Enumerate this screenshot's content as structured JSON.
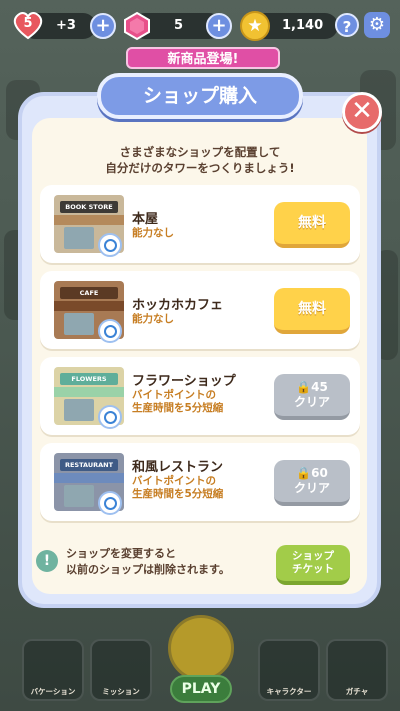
{
  "hud": {
    "lives": "5",
    "lives_bonus": "+3",
    "gems": "5",
    "coins": "1,140",
    "help_label": "?"
  },
  "new_badge": "新商品登場!",
  "modal": {
    "title": "ショップ購入",
    "intro_line1": "さまざまなショップを配置して",
    "intro_line2": "自分だけのタワーをつくりましょう!",
    "shops": [
      {
        "sign": "BOOK STORE",
        "name": "本屋",
        "desc1": "能力なし",
        "desc2": "",
        "button": "無料",
        "locked": false,
        "sign_color": "#3d3a36",
        "awning_color": "#b48a5c"
      },
      {
        "sign": "CAFE",
        "name": "ホッカホカフェ",
        "desc1": "能力なし",
        "desc2": "",
        "button": "無料",
        "locked": false,
        "sign_color": "#5b3a24",
        "awning_color": "#7a4a2a"
      },
      {
        "sign": "FLOWERS",
        "name": "フラワーショップ",
        "desc1": "バイトポイントの",
        "desc2": "生産時間を5分短縮",
        "button_num": "45",
        "button_label": "クリア",
        "locked": true,
        "sign_color": "#5fae9a",
        "awning_color": "#9ad2a8"
      },
      {
        "sign": "RESTAURANT",
        "name": "和風レストラン",
        "desc1": "バイトポイントの",
        "desc2": "生産時間を5分短縮",
        "button_num": "60",
        "button_label": "クリア",
        "locked": true,
        "sign_color": "#3f5b86",
        "awning_color": "#6d8bbd"
      }
    ],
    "footer_line1": "ショップを変更すると",
    "footer_line2": "以前のショップは削除されます。",
    "ticket_line1": "ショップ",
    "ticket_line2": "チケット"
  },
  "nav": {
    "items": [
      "バケーション",
      "ミッション",
      "",
      "キャラクター",
      "ガチャ"
    ],
    "play": "PLAY"
  },
  "colors": {
    "accent_blue": "#7d9be6",
    "free_button": "#ffd24a",
    "ticket_button": "#a2cc49",
    "close_button": "#e76b6b"
  }
}
